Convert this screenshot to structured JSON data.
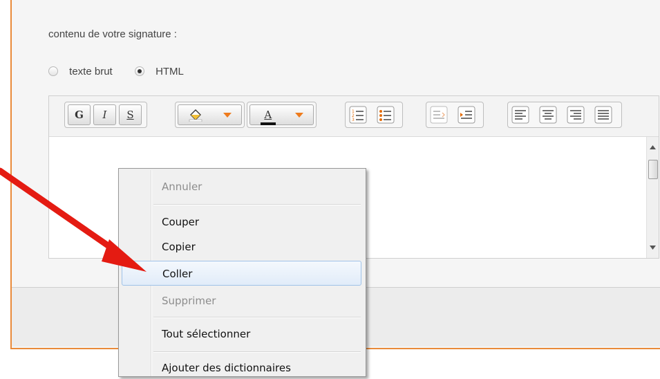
{
  "signature": {
    "label": "contenu de votre signature :",
    "format_options": [
      {
        "label": "texte brut",
        "selected": false
      },
      {
        "label": "HTML",
        "selected": true
      }
    ]
  },
  "toolbar": {
    "bold_label": "G",
    "italic_label": "I",
    "strike_label": "S",
    "text_color_label": "A"
  },
  "context_menu": {
    "items": [
      {
        "label": "Annuler",
        "disabled": true
      },
      {
        "label": "Couper",
        "disabled": false
      },
      {
        "label": "Copier",
        "disabled": false
      },
      {
        "label": "Coller",
        "disabled": false,
        "highlighted": true
      },
      {
        "label": "Supprimer",
        "disabled": true
      },
      {
        "label": "Tout sélectionner",
        "disabled": false
      },
      {
        "label": "Ajouter des dictionnaires",
        "disabled": false
      }
    ]
  },
  "colors": {
    "accent_orange": "#e98a3a",
    "arrow_red": "#e41b12",
    "highlight_border": "#9fc2e8"
  }
}
